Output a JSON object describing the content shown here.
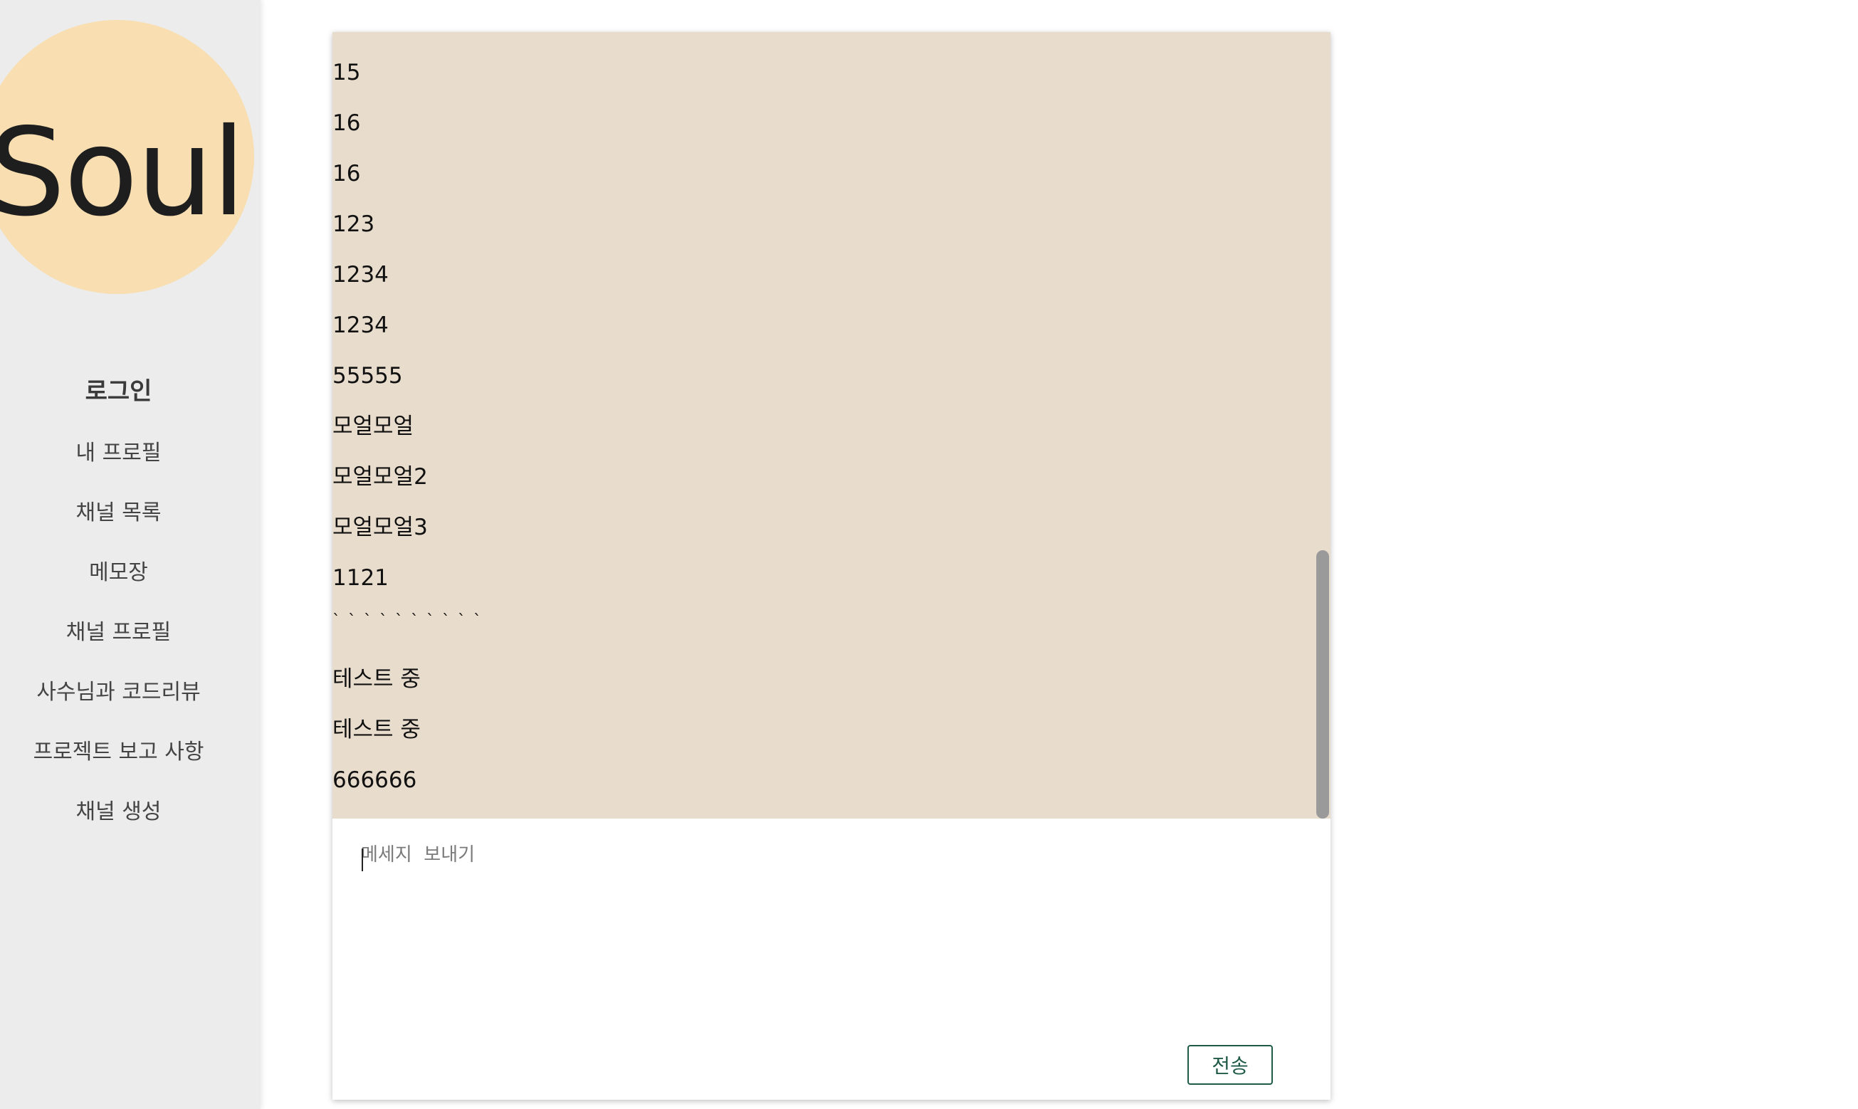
{
  "sidebar": {
    "logo_text": "Soul",
    "login_label": "로그인",
    "items": [
      {
        "label": "내 프로필"
      },
      {
        "label": "채널 목록"
      },
      {
        "label": "메모장"
      },
      {
        "label": "채널 프로필"
      },
      {
        "label": "사수님과 코드리뷰"
      },
      {
        "label": "프로젝트 보고 사항"
      },
      {
        "label": "채널 생성"
      }
    ]
  },
  "chat": {
    "messages": [
      "15",
      "16",
      "16",
      "123",
      "1234",
      "1234",
      "55555",
      "모얼모얼",
      "모얼모얼2",
      "모얼모얼3",
      "1121",
      "` ` ` ` ` ` ` ` ` `",
      "테스트 중",
      "테스트 중",
      "666666"
    ],
    "input_placeholder": "메세지  보내기",
    "input_value": "",
    "send_label": "전송"
  },
  "colors": {
    "sidebar_bg": "#ececec",
    "logo_bg": "#f8deb0",
    "messages_bg": "#e8dccc",
    "send_border": "#1f5a48"
  }
}
